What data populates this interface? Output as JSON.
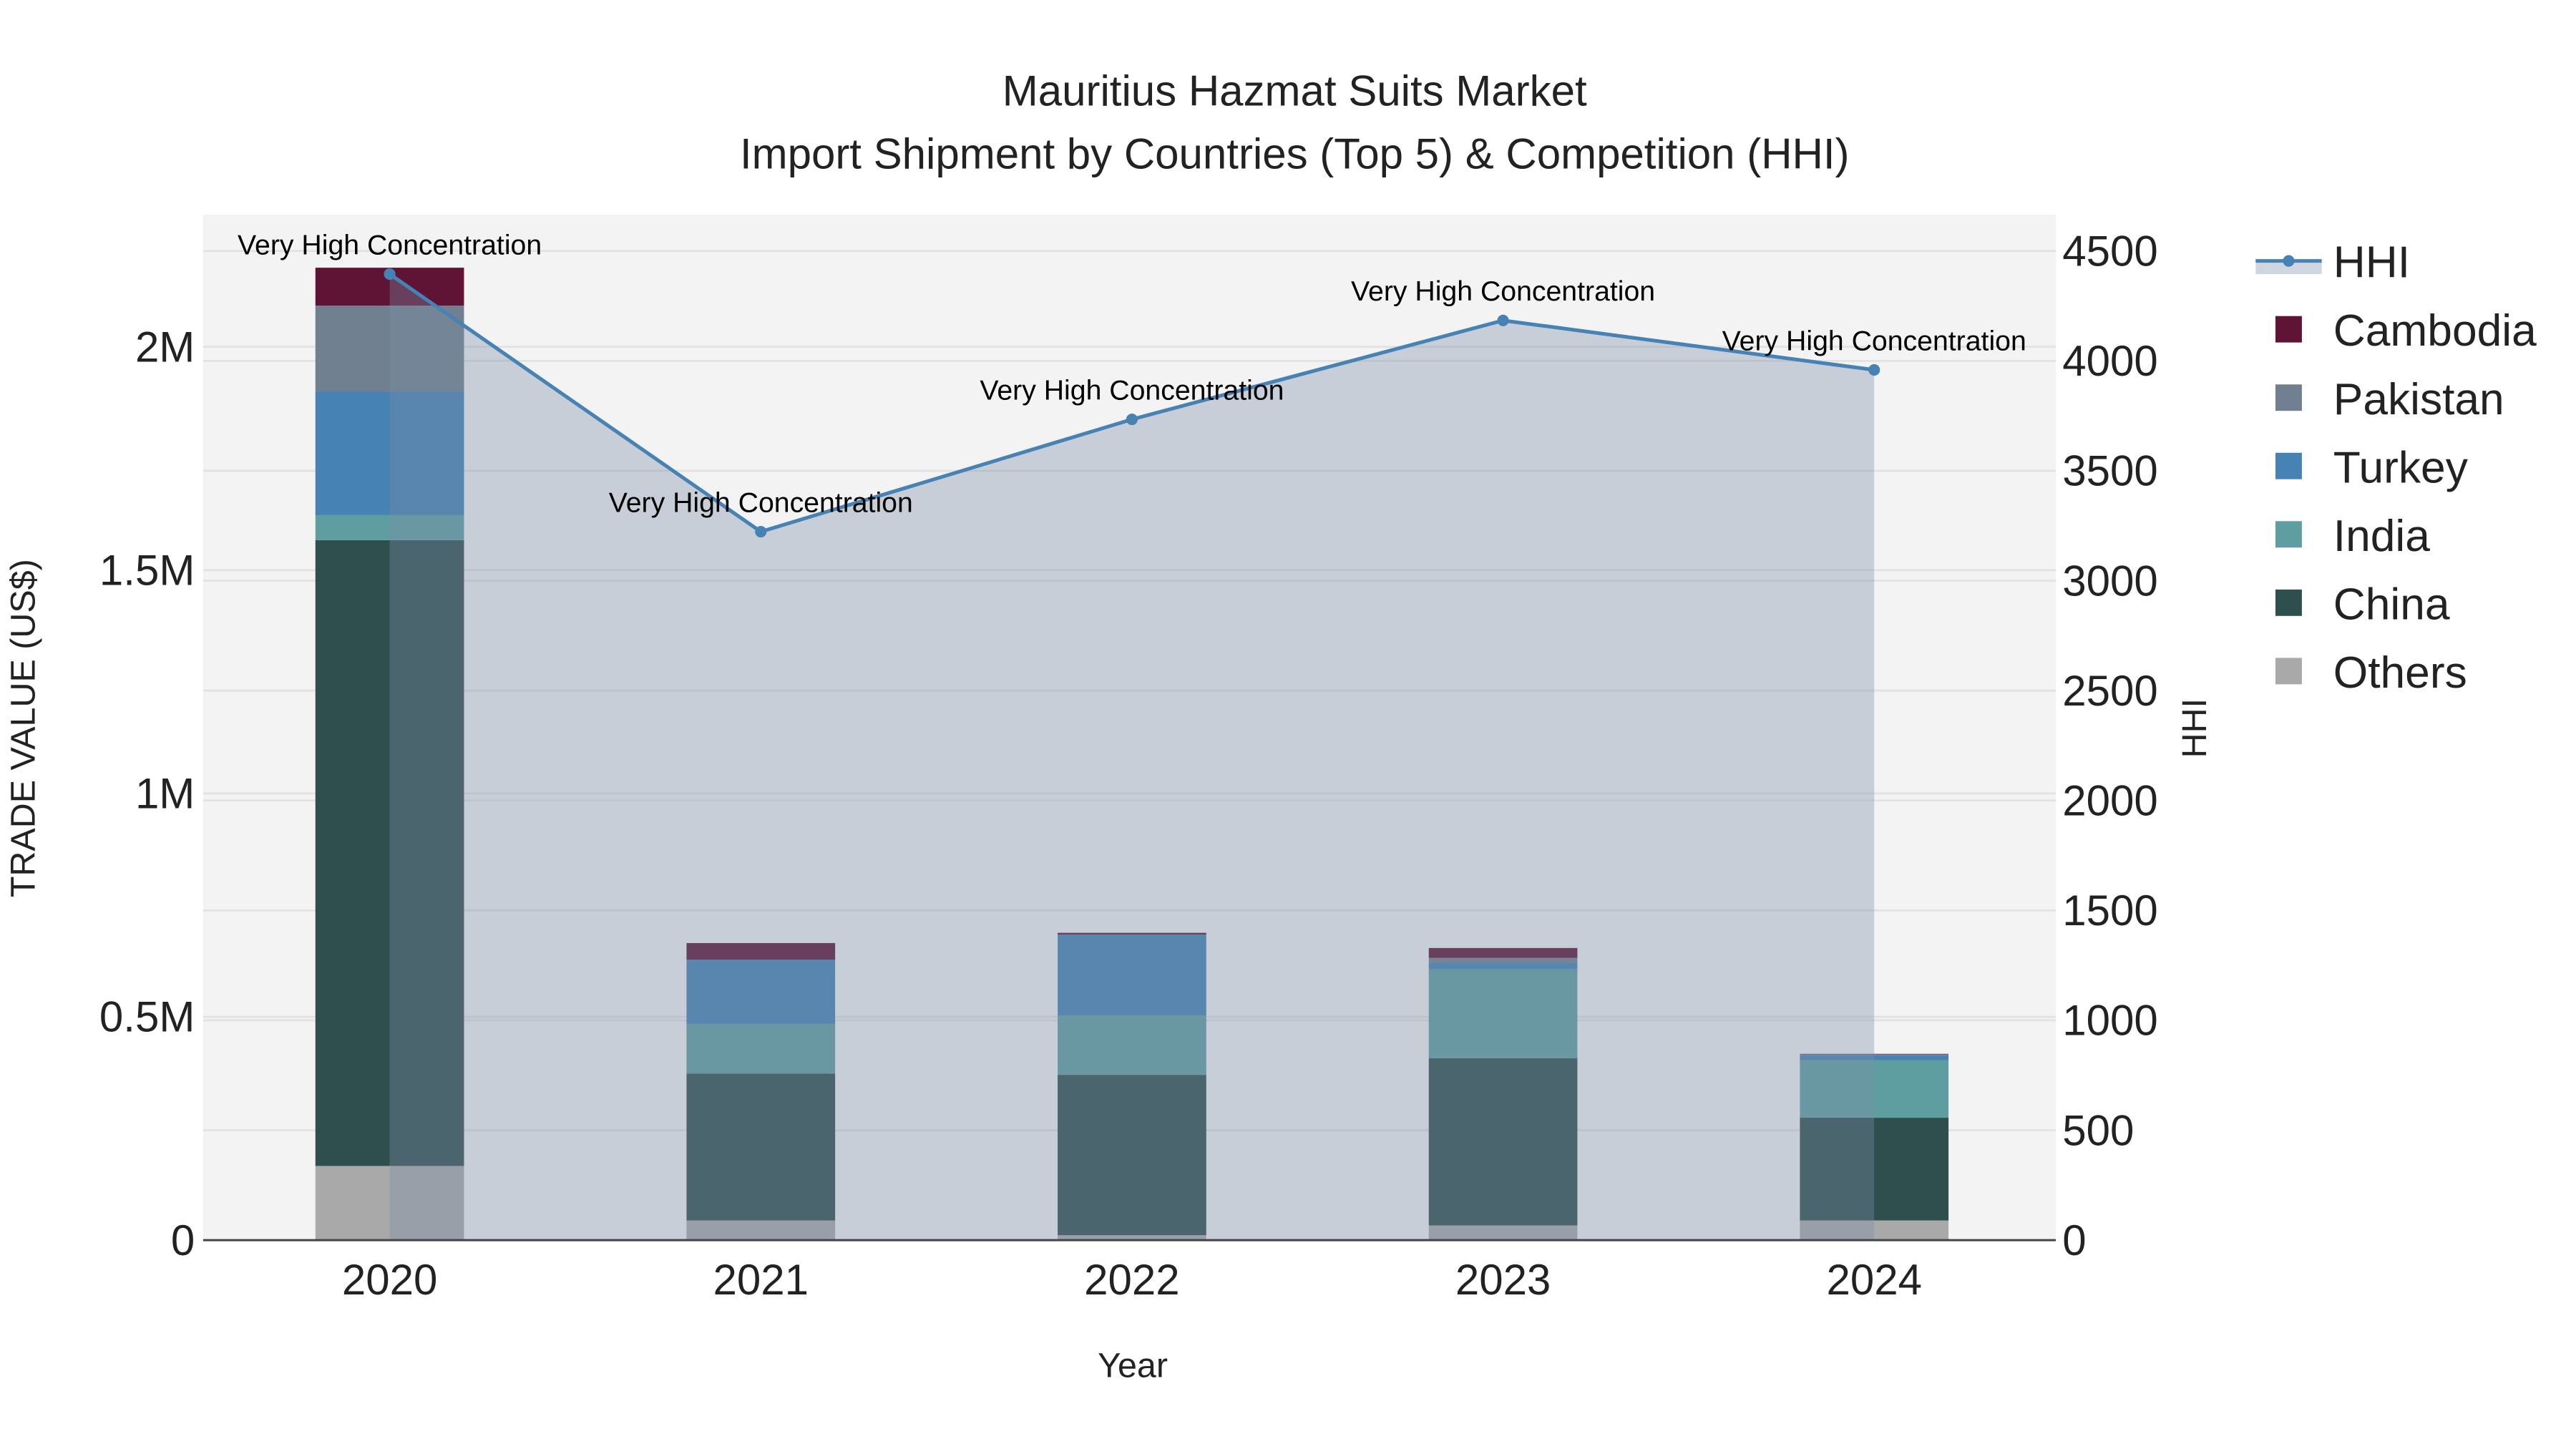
{
  "chart_data": {
    "type": "bar",
    "title_line1": "Mauritius Hazmat Suits Market",
    "title_line2": "Import Shipment by Countries (Top 5) & Competition (HHI)",
    "xlabel": "Year",
    "ylabel": "TRADE VALUE (US$)",
    "y2label": "HHI",
    "categories": [
      "2020",
      "2021",
      "2022",
      "2023",
      "2024"
    ],
    "ylim": [
      0,
      2300000
    ],
    "y_ticks": [
      {
        "v": 0,
        "label": "0"
      },
      {
        "v": 500000,
        "label": "0.5M"
      },
      {
        "v": 1000000,
        "label": "1M"
      },
      {
        "v": 1500000,
        "label": "1.5M"
      },
      {
        "v": 2000000,
        "label": "2M"
      }
    ],
    "y2lim": [
      0,
      4650
    ],
    "y2_ticks": [
      "0",
      "500",
      "1000",
      "1500",
      "2000",
      "2500",
      "3000",
      "3500",
      "4000",
      "4500"
    ],
    "stacked": true,
    "series": [
      {
        "name": "Others",
        "color": "#a9a9a9",
        "values": [
          166000,
          44000,
          11000,
          33000,
          44000
        ]
      },
      {
        "name": "China",
        "color": "#2f4f4f",
        "values": [
          1401000,
          329000,
          359000,
          374000,
          230000
        ]
      },
      {
        "name": "India",
        "color": "#5f9ea0",
        "values": [
          56000,
          111000,
          133000,
          199000,
          129000
        ]
      },
      {
        "name": "Turkey",
        "color": "#4682b4",
        "values": [
          277000,
          144000,
          181000,
          15000,
          11000
        ]
      },
      {
        "name": "Pakistan",
        "color": "#708090",
        "values": [
          192000,
          0,
          0,
          11000,
          2000
        ]
      },
      {
        "name": "Cambodia",
        "color": "#5f1436",
        "values": [
          85000,
          37000,
          4000,
          22000,
          1000
        ]
      }
    ],
    "line_series": {
      "name": "HHI",
      "color": "#4682b4",
      "axis": "y2",
      "values": [
        4395,
        3223,
        3734,
        4184,
        3959
      ],
      "annotations": [
        "Very High Concentration",
        "Very High Concentration",
        "Very High Concentration",
        "Very High Concentration",
        "Very High Concentration"
      ]
    },
    "legend_order": [
      "HHI",
      "Cambodia",
      "Pakistan",
      "Turkey",
      "India",
      "China",
      "Others"
    ],
    "legend_position": "right",
    "grid": true
  }
}
